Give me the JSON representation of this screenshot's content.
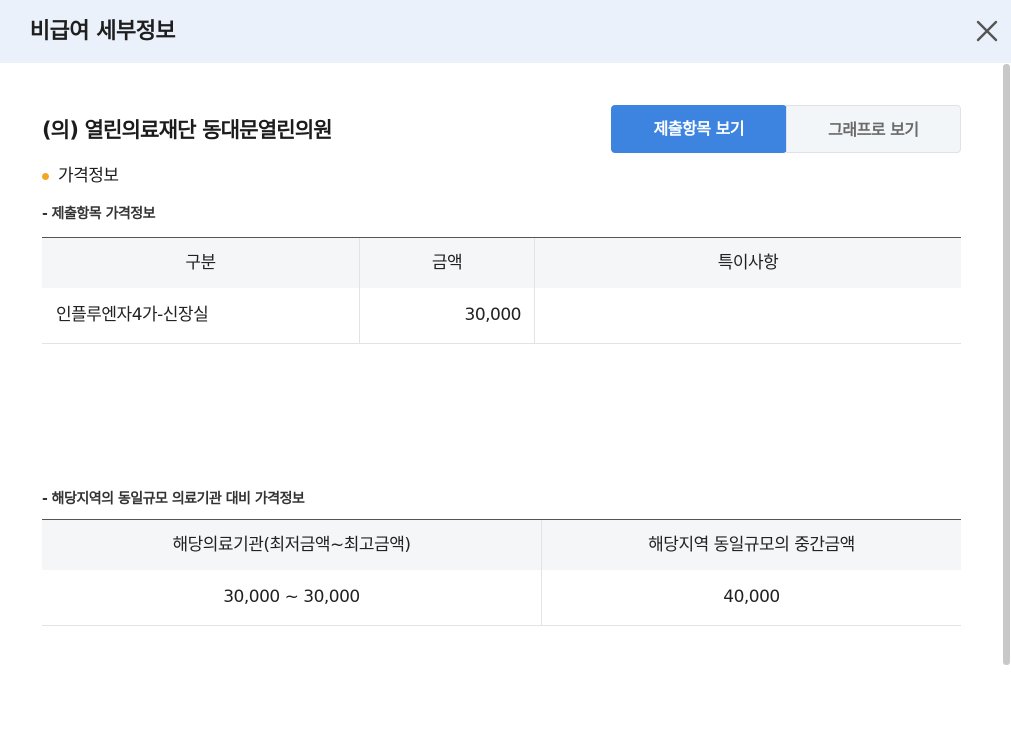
{
  "dialog": {
    "title": "비급여 세부정보",
    "close_icon": "close-icon"
  },
  "hospital": {
    "name": "(의) 열린의료재단 동대문열린의원"
  },
  "view_toggle": {
    "active_label": "제출항목 보기",
    "inactive_label": "그래프로 보기",
    "active_color": "#3d84e0"
  },
  "price_section": {
    "label": "가격정보",
    "bullet_color": "#f5a623"
  },
  "submitted_items": {
    "heading": "- 제출항목 가격정보",
    "columns": [
      "구분",
      "금액",
      "특이사항"
    ],
    "rows": [
      {
        "category": "인플루엔자4가-신장실",
        "amount": "30,000",
        "note": ""
      }
    ]
  },
  "regional_comparison": {
    "heading": "- 해당지역의 동일규모 의료기관 대비 가격정보",
    "columns": [
      "해당의료기관(최저금액~최고금액)",
      "해당지역 동일규모의 중간금액"
    ],
    "rows": [
      {
        "range": "30,000 ~ 30,000",
        "median": "40,000"
      }
    ]
  }
}
